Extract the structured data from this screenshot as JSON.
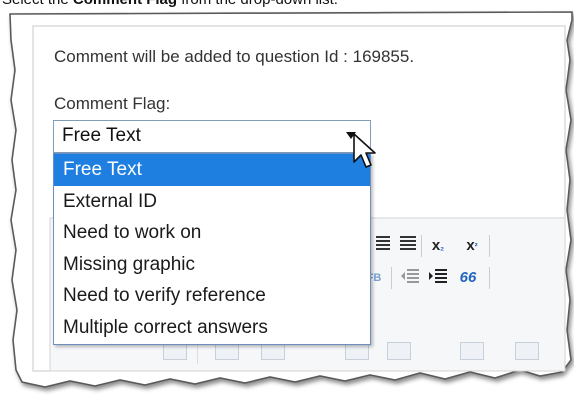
{
  "caption": {
    "prefix": "Select the ",
    "bold": "Comment Flag",
    "suffix": " from the drop-down list."
  },
  "dialog": {
    "info_text": "Comment will be added to question Id : 169855.",
    "flag_label": "Comment Flag:",
    "select": {
      "current_value": "Free Text",
      "options": [
        "Free Text",
        "External ID",
        "Need to work on",
        "Missing graphic",
        "Need to verify reference",
        "Multiple correct answers"
      ],
      "highlighted_index": 0
    }
  },
  "toolbar": {
    "subscript_label": "x",
    "subscript_mark": "₂",
    "superscript_label": "x",
    "superscript_mark": "²",
    "quote_label": "66",
    "align_justify_icon": "align-justify-icon",
    "indent_icon": "indent-icon",
    "outdent_icon": "outdent-icon",
    "table_icon": "table-icon"
  },
  "colors": {
    "highlight": "#1e7fe0",
    "select_border": "#7f9db9"
  }
}
